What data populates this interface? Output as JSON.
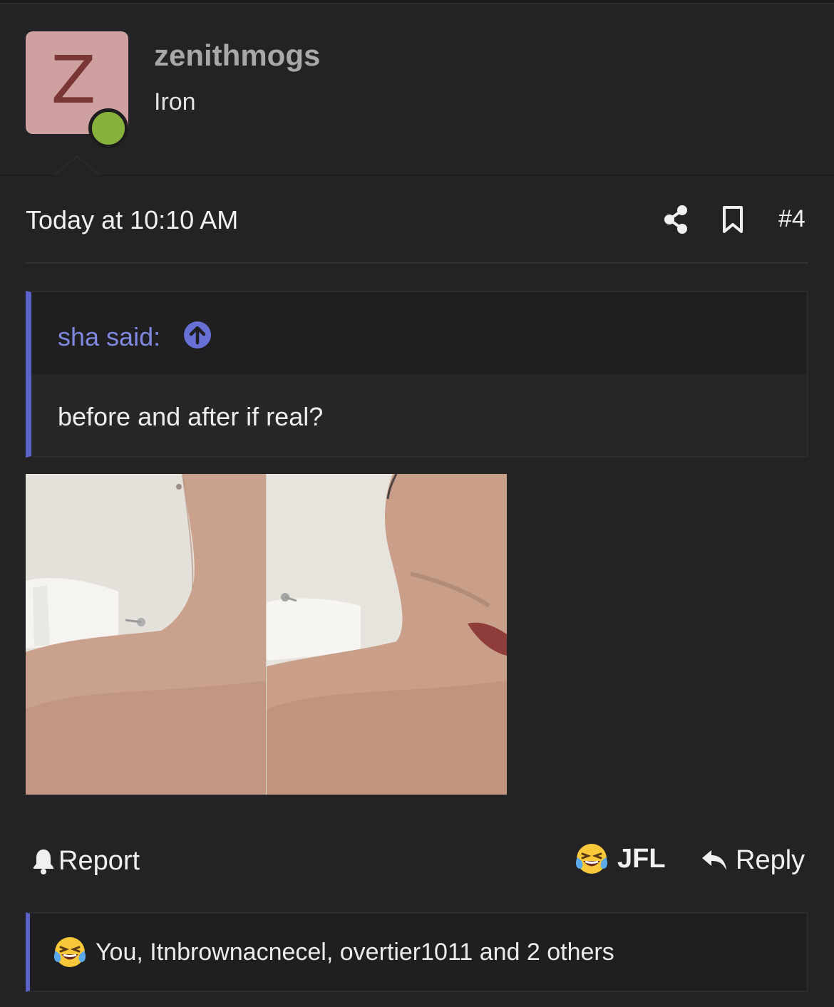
{
  "user": {
    "avatar_letter": "Z",
    "avatar_color": "#cfa0a0",
    "online_color": "#86b13a",
    "username": "zenithmogs",
    "title": "Iron"
  },
  "post": {
    "date": "Today at 10:10 AM",
    "number": "#4",
    "share_icon": "share-icon",
    "bookmark_icon": "bookmark-icon"
  },
  "quote": {
    "author": "sha said:",
    "text": "before and after if real?",
    "accent": "#5b62c7"
  },
  "actions": {
    "report": "Report",
    "reaction": "JFL",
    "reply": "Reply"
  },
  "reactions": {
    "summary": "You, Itnbrownacnecel, overtier1011 and 2 others"
  }
}
